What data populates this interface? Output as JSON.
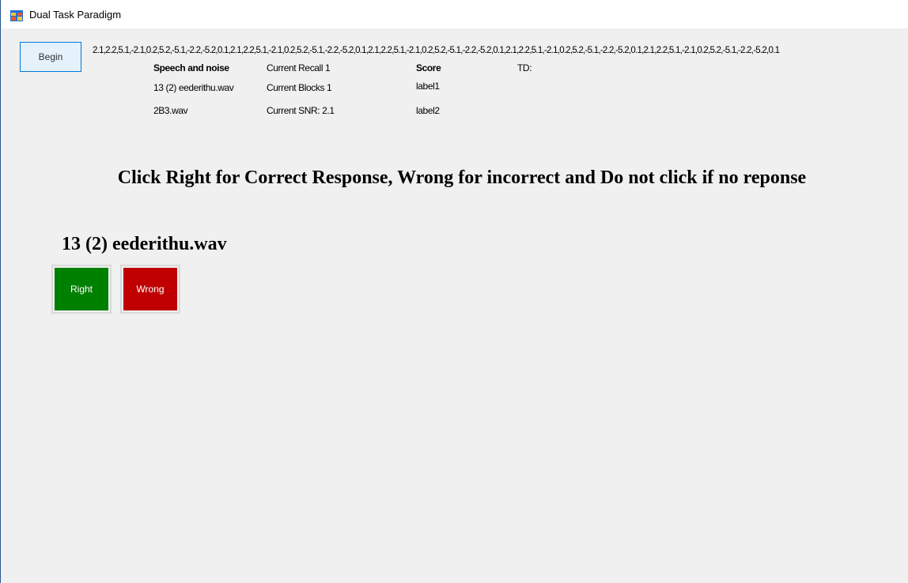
{
  "window": {
    "title": "Dual Task Paradigm",
    "icon": "windows-form-icon"
  },
  "controls": {
    "begin_label": "Begin"
  },
  "sequence_text": "2.1,2.2,5.1,-2.1,0.2,5.2,-5.1,-2.2,-5.2,0.1,2.1,2.2,5.1,-2.1,0.2,5.2,-5.1,-2.2,-5.2,0.1,2.1,2.2,5.1,-2.1,0.2,5.2,-5.1,-2.2,-5.2,0.1,2.1,2.2,5.1,-2.1,0.2,5.2,-5.1,-2.2,-5.2,0.1,2.1,2.2,5.1,-2.1,0.2,5.2,-5.1,-2.2,-5.2,0.1",
  "info": {
    "speech_noise_header": "Speech and noise",
    "speech_file": "13 (2) eederithu.wav",
    "noise_file": "2B3.wav",
    "current_recall": "Current Recall 1",
    "current_blocks": "Current Blocks 1",
    "current_snr": "Current SNR: 2.1",
    "score_header": "Score",
    "score_label1": "label1",
    "score_label2": "label2",
    "td_label": "TD:"
  },
  "instruction": "Click Right for Correct Response, Wrong for incorrect and Do not click if no reponse",
  "current_file": "13 (2) eederithu.wav",
  "response": {
    "right_label": "Right",
    "wrong_label": "Wrong",
    "right_color": "#008000",
    "wrong_color": "#c00000"
  }
}
